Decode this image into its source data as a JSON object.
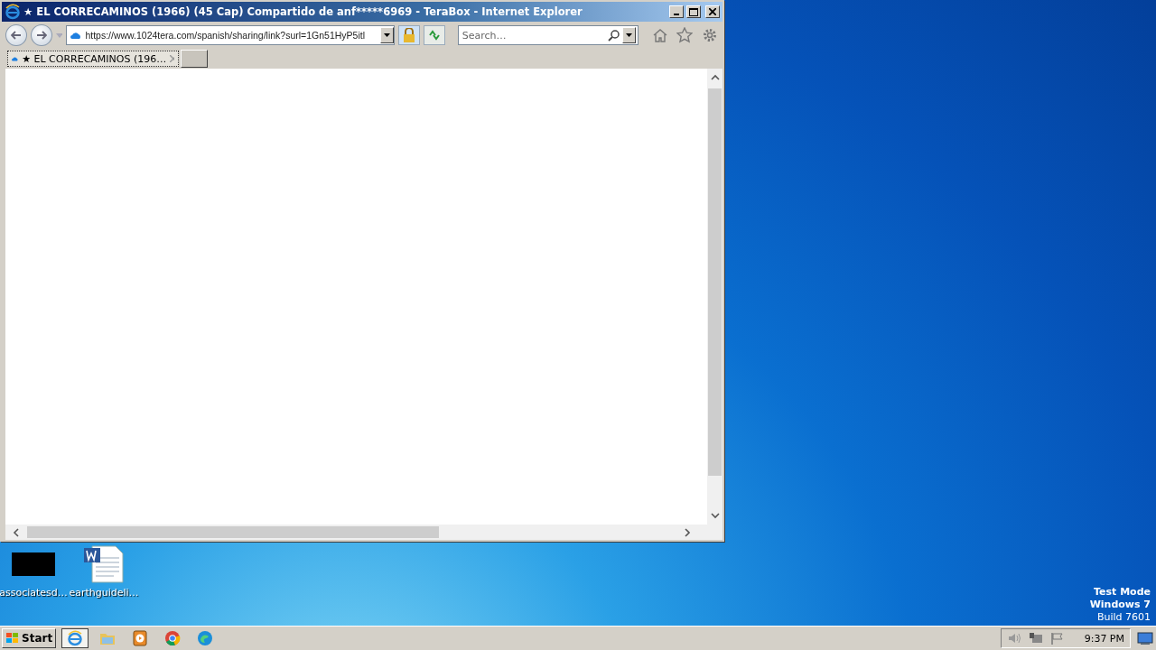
{
  "window": {
    "title": "★ EL CORRECAMINOS (1966) (45 Cap) Compartido de anf*****6969 - TeraBox - Internet Explorer"
  },
  "address_bar": {
    "url": "https://www.1024tera.com/spanish/sharing/link?surl=1Gn51HyP5itl"
  },
  "search": {
    "placeholder": "Search…"
  },
  "tabs": [
    {
      "label": "★ EL CORRECAMINOS (196…",
      "selected": true
    }
  ],
  "desktop_icons": [
    {
      "label": "associatesd…",
      "kind": "video"
    },
    {
      "label": "earthguideli…",
      "kind": "document"
    }
  ],
  "desktop_notice": [
    "Test Mode",
    "Windows 7",
    "Build 7601"
  ],
  "taskbar": {
    "start": "Start",
    "apps": [
      {
        "kind": "ie",
        "selected": true
      },
      {
        "kind": "folder",
        "selected": false
      },
      {
        "kind": "media",
        "selected": false
      },
      {
        "kind": "chrome",
        "selected": false
      },
      {
        "kind": "edge",
        "selected": false
      }
    ],
    "clock": "9:37 PM"
  }
}
